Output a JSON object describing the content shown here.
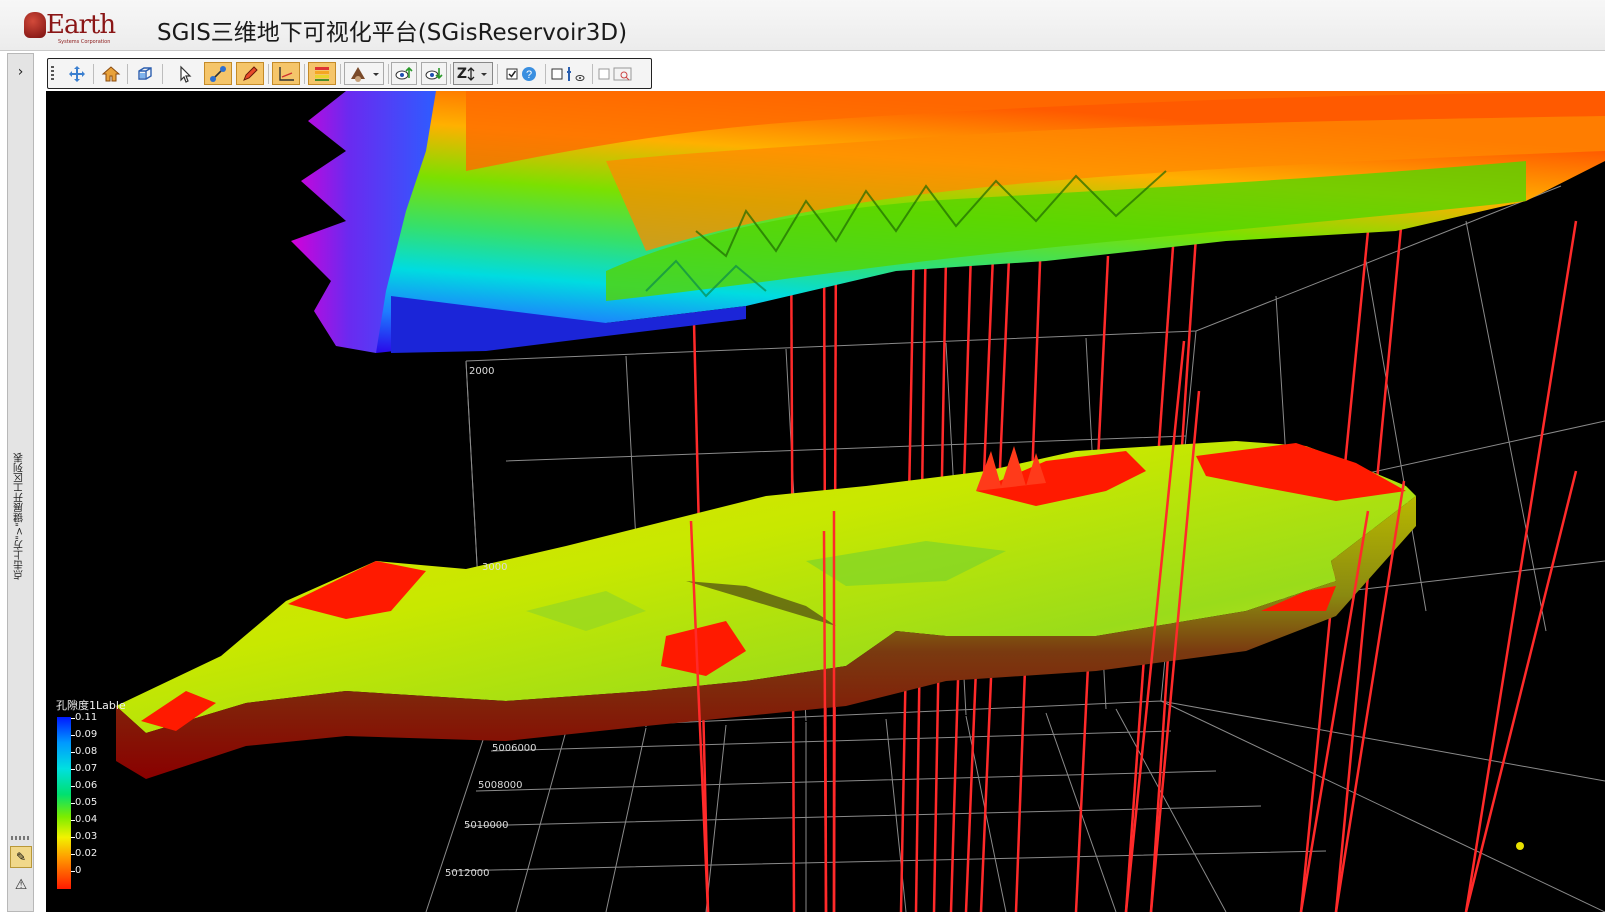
{
  "app": {
    "logo_text": "Earth",
    "logo_sub": "Systems Corporation",
    "title": "SGIS三维地下可视化平台(SGisReservoir3D)"
  },
  "left_panel": {
    "expand_glyph": "›",
    "vertical_label": "点击上方\">\"键展开工区列表"
  },
  "toolbar": {
    "buttons": [
      {
        "name": "pan-icon",
        "active": false
      },
      {
        "name": "home-icon",
        "active": false
      },
      {
        "name": "bounding-box-icon",
        "active": false
      },
      {
        "name": "select-pointer-icon",
        "active": false
      },
      {
        "name": "well-connect-icon",
        "active": true
      },
      {
        "name": "pencil-edit-icon",
        "active": true
      },
      {
        "name": "axis-grid-icon",
        "active": true
      },
      {
        "name": "layer-stack-icon",
        "active": true
      },
      {
        "name": "light-dropdown-icon",
        "active": false
      },
      {
        "name": "eye-up-icon",
        "active": false
      },
      {
        "name": "eye-down-icon",
        "active": false
      },
      {
        "name": "z-scale-dropdown-icon",
        "active": false
      },
      {
        "name": "checkbox-help-icon",
        "active": false
      },
      {
        "name": "checkbox-well-view-icon",
        "active": false
      },
      {
        "name": "checkbox-screenshot-icon",
        "active": false
      }
    ],
    "z_label": "Z"
  },
  "viewport": {
    "depth_ticks": [
      "2000",
      "3000"
    ],
    "y_ticks": [
      "5006000",
      "5008000",
      "5010000",
      "5012000"
    ],
    "legend": {
      "title": "孔隙度1Lable",
      "values": [
        "0.11",
        "0.09",
        "0.08",
        "0.07",
        "0.06",
        "0.05",
        "0.04",
        "0.03",
        "0.02",
        "0"
      ]
    }
  },
  "colors": {
    "background": "#000000",
    "well": "#ff2a2a",
    "toolbar_active": "#f5c56a",
    "logo": "#8a1616"
  }
}
